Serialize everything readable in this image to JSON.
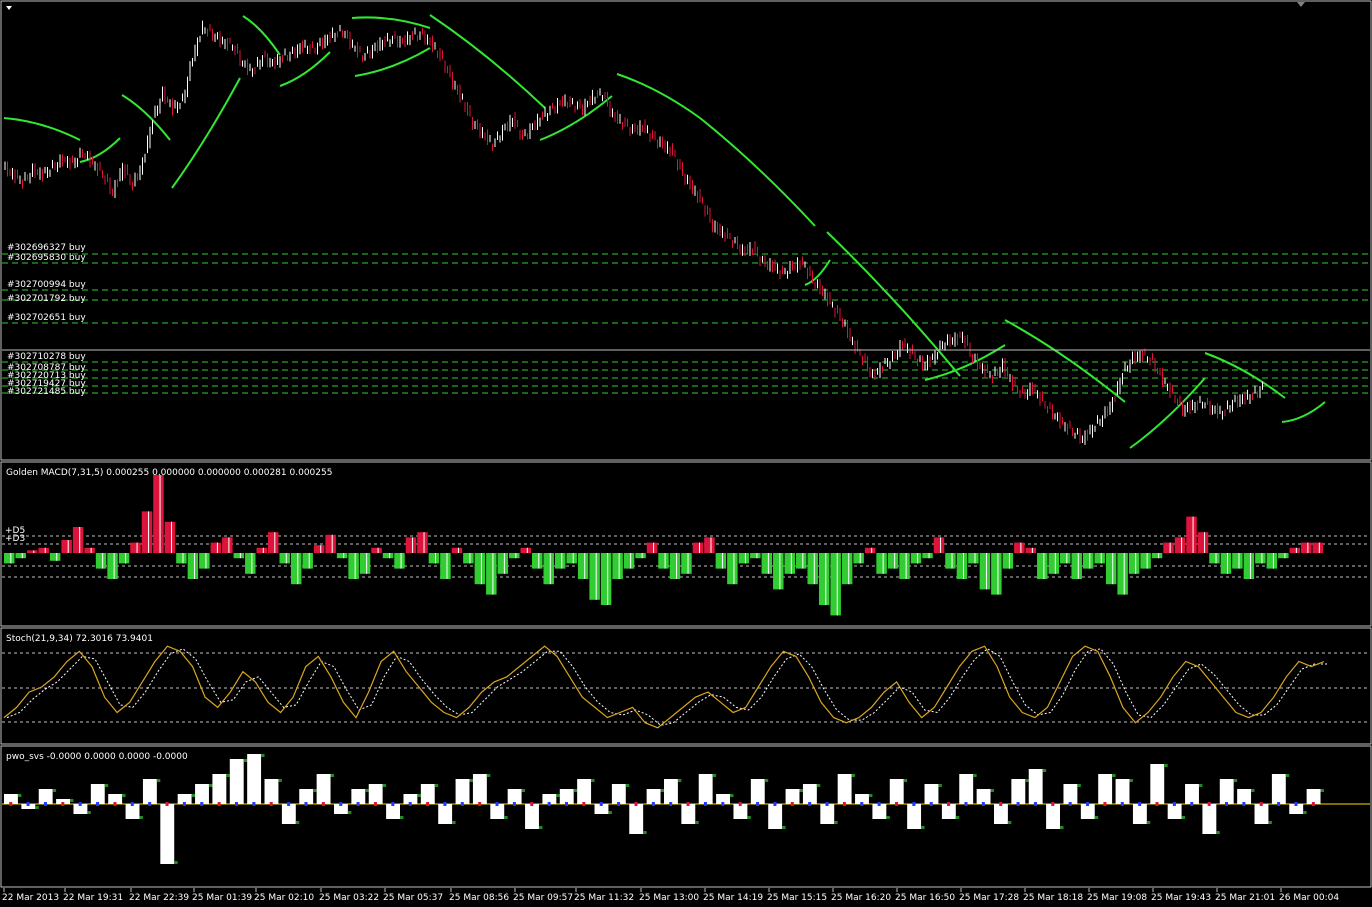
{
  "windows": {
    "macd_title": "Golden MACD(7,31,5) 0.000255 0.000000 0.000000 0.000281 0.000255",
    "macd_levels": [
      "+D5",
      "+D3"
    ],
    "stoch_title": "Stoch(21,9,34) 72.3016 73.9401",
    "pwo_title": "pwo_svs -0.0000 0.0000 0.0000 -0.0000"
  },
  "orders": [
    {
      "label": "#302696327 buy"
    },
    {
      "label": "#302695830 buy"
    },
    {
      "label": "#302700994 buy"
    },
    {
      "label": "#302701792 buy"
    },
    {
      "label": "#302702651 buy"
    },
    {
      "label": "#302710278 buy"
    },
    {
      "label": "#302708787 buy"
    },
    {
      "label": "#302720713 buy"
    },
    {
      "label": "#302719427 buy"
    },
    {
      "label": "#302721485 buy"
    }
  ],
  "time_axis": [
    "22 Mar 2013",
    "22 Mar 19:31",
    "22 Mar 22:39",
    "25 Mar 01:39",
    "25 Mar 02:10",
    "25 Mar 03:22",
    "25 Mar 05:37",
    "25 Mar 08:56",
    "25 Mar 09:57",
    "25 Mar 11:32",
    "25 Mar 13:00",
    "25 Mar 14:19",
    "25 Mar 15:15",
    "25 Mar 16:20",
    "25 Mar 16:50",
    "25 Mar 17:28",
    "25 Mar 18:18",
    "25 Mar 19:08",
    "25 Mar 19:43",
    "25 Mar 21:01",
    "26 Mar 00:04"
  ],
  "colors": {
    "background": "#000000",
    "bull_candle": "#ffffff",
    "bear_candle": "#dc143c",
    "ma_line": "#32e632",
    "order_line": "#32cd32",
    "macd_up": "#dc143c",
    "macd_down": "#32cd32",
    "stoch_main": "#daa520",
    "stoch_signal": "#ffffff",
    "pwo_zero": "#ffd700"
  },
  "chart_data": [
    {
      "type": "line",
      "name": "price",
      "x": [
        0,
        10,
        20,
        30,
        40,
        50,
        60,
        70,
        80,
        90,
        100,
        110,
        120,
        130,
        140,
        150,
        160,
        170,
        180,
        190,
        200,
        210,
        220,
        230,
        240,
        250,
        260,
        270,
        280,
        290,
        300,
        310,
        320,
        330,
        340,
        350,
        360,
        370,
        380,
        390,
        400,
        410,
        420,
        430,
        440,
        450,
        460,
        470,
        480,
        490,
        500,
        510,
        520,
        530,
        540,
        550,
        560,
        570,
        580,
        590,
        600,
        610,
        620,
        630,
        640,
        650,
        660,
        670,
        680,
        690,
        700,
        710,
        720,
        730,
        740,
        750,
        760,
        770,
        780,
        790,
        800,
        810,
        820,
        830,
        840,
        850,
        860,
        870,
        880,
        890,
        900,
        910,
        920,
        930,
        940,
        950,
        960,
        970,
        980,
        990,
        1000,
        1010,
        1020,
        1030,
        1040,
        1050,
        1060,
        1070,
        1080,
        1090,
        1100,
        1110,
        1120,
        1130,
        1140,
        1150,
        1160,
        1170,
        1180,
        1190,
        1200,
        1210,
        1220,
        1230,
        1240,
        1250,
        1260,
        1270,
        1280,
        1290,
        1300,
        1310,
        1320
      ],
      "values": [
        0.62,
        0.6,
        0.58,
        0.61,
        0.6,
        0.62,
        0.64,
        0.63,
        0.66,
        0.63,
        0.6,
        0.55,
        0.62,
        0.57,
        0.63,
        0.75,
        0.82,
        0.78,
        0.8,
        0.92,
        1.0,
        0.98,
        0.96,
        0.95,
        0.9,
        0.88,
        0.92,
        0.9,
        0.92,
        0.93,
        0.95,
        0.94,
        0.96,
        0.98,
        0.99,
        0.95,
        0.92,
        0.94,
        0.96,
        0.97,
        0.96,
        0.98,
        0.98,
        0.95,
        0.91,
        0.85,
        0.8,
        0.74,
        0.71,
        0.68,
        0.72,
        0.75,
        0.7,
        0.73,
        0.76,
        0.78,
        0.8,
        0.79,
        0.78,
        0.81,
        0.82,
        0.76,
        0.74,
        0.72,
        0.73,
        0.7,
        0.68,
        0.66,
        0.6,
        0.56,
        0.52,
        0.46,
        0.44,
        0.42,
        0.39,
        0.4,
        0.36,
        0.35,
        0.33,
        0.35,
        0.36,
        0.31,
        0.28,
        0.24,
        0.2,
        0.14,
        0.1,
        0.05,
        0.08,
        0.1,
        0.14,
        0.11,
        0.08,
        0.1,
        0.14,
        0.15,
        0.16,
        0.1,
        0.07,
        0.05,
        0.08,
        0.03,
        0.0,
        0.02,
        -0.02,
        -0.05,
        -0.08,
        -0.1,
        -0.12,
        -0.09,
        -0.06,
        -0.02,
        0.06,
        0.1,
        0.11,
        0.09,
        0.04,
        0.0,
        -0.04,
        -0.03,
        -0.02,
        -0.04,
        -0.05,
        -0.02,
        -0.01,
        0.0,
        0.02
      ]
    },
    {
      "type": "bar",
      "name": "macd",
      "values": [
        -0.2,
        -0.1,
        0.05,
        0.1,
        -0.15,
        0.25,
        0.5,
        0.1,
        -0.3,
        -0.5,
        -0.2,
        0.2,
        0.8,
        1.5,
        0.6,
        -0.2,
        -0.5,
        -0.3,
        0.2,
        0.3,
        -0.1,
        -0.4,
        0.1,
        0.4,
        -0.2,
        -0.6,
        -0.3,
        0.15,
        0.35,
        -0.1,
        -0.5,
        -0.4,
        0.1,
        -0.1,
        -0.3,
        0.3,
        0.4,
        -0.2,
        -0.5,
        0.1,
        -0.2,
        -0.6,
        -0.8,
        -0.4,
        -0.1,
        0.1,
        -0.3,
        -0.6,
        -0.3,
        -0.2,
        -0.5,
        -0.9,
        -1.0,
        -0.5,
        -0.3,
        -0.1,
        0.2,
        -0.3,
        -0.5,
        -0.4,
        0.2,
        0.3,
        -0.3,
        -0.6,
        -0.2,
        -0.1,
        -0.4,
        -0.7,
        -0.4,
        -0.3,
        -0.6,
        -1.0,
        -1.2,
        -0.6,
        -0.2,
        0.1,
        -0.4,
        -0.3,
        -0.5,
        -0.2,
        -0.1,
        0.3,
        -0.3,
        -0.5,
        -0.2,
        -0.7,
        -0.8,
        -0.3,
        0.2,
        0.1,
        -0.5,
        -0.4,
        -0.2,
        -0.5,
        -0.3,
        -0.2,
        -0.6,
        -0.8,
        -0.4,
        -0.3,
        -0.1,
        0.2,
        0.3,
        0.7,
        0.4,
        -0.2,
        -0.4,
        -0.3,
        -0.5,
        -0.2,
        -0.3,
        -0.1,
        0.1,
        0.2,
        0.2
      ],
      "levels": {
        "+D5": 0.5,
        "+D3": 0.3
      }
    },
    {
      "type": "line",
      "name": "stoch",
      "ylim": [
        0,
        100
      ],
      "values": [
        20,
        30,
        45,
        50,
        60,
        75,
        85,
        70,
        40,
        25,
        35,
        55,
        75,
        90,
        85,
        70,
        40,
        30,
        45,
        65,
        55,
        35,
        25,
        40,
        70,
        80,
        60,
        35,
        20,
        45,
        75,
        85,
        65,
        50,
        35,
        25,
        20,
        30,
        45,
        55,
        60,
        70,
        80,
        90,
        80,
        60,
        40,
        30,
        20,
        25,
        30,
        15,
        10,
        20,
        30,
        40,
        45,
        35,
        25,
        30,
        50,
        70,
        85,
        80,
        60,
        35,
        20,
        15,
        20,
        30,
        45,
        55,
        35,
        20,
        30,
        50,
        70,
        85,
        90,
        70,
        40,
        25,
        20,
        30,
        55,
        80,
        90,
        85,
        60,
        30,
        15,
        25,
        40,
        60,
        75,
        70,
        55,
        40,
        25,
        20,
        25,
        40,
        60,
        75,
        70,
        75
      ]
    },
    {
      "type": "bar",
      "name": "pwo",
      "values": [
        0.2,
        -0.1,
        0.3,
        0.1,
        -0.2,
        0.4,
        0.2,
        -0.3,
        0.5,
        -1.2,
        0.2,
        0.4,
        0.6,
        0.9,
        1.0,
        0.5,
        -0.4,
        0.3,
        0.6,
        -0.2,
        0.3,
        0.4,
        -0.3,
        0.2,
        0.4,
        -0.4,
        0.5,
        0.6,
        -0.3,
        0.3,
        -0.5,
        0.2,
        0.3,
        0.5,
        -0.2,
        0.4,
        -0.6,
        0.3,
        0.5,
        -0.4,
        0.6,
        0.2,
        -0.3,
        0.5,
        -0.5,
        0.3,
        0.4,
        -0.4,
        0.6,
        0.2,
        -0.3,
        0.5,
        -0.5,
        0.4,
        -0.3,
        0.6,
        0.3,
        -0.4,
        0.5,
        0.7,
        -0.5,
        0.4,
        -0.3,
        0.6,
        0.5,
        -0.4,
        0.8,
        -0.3,
        0.4,
        -0.6,
        0.5,
        0.3,
        -0.4,
        0.6,
        -0.2,
        0.3
      ]
    }
  ]
}
